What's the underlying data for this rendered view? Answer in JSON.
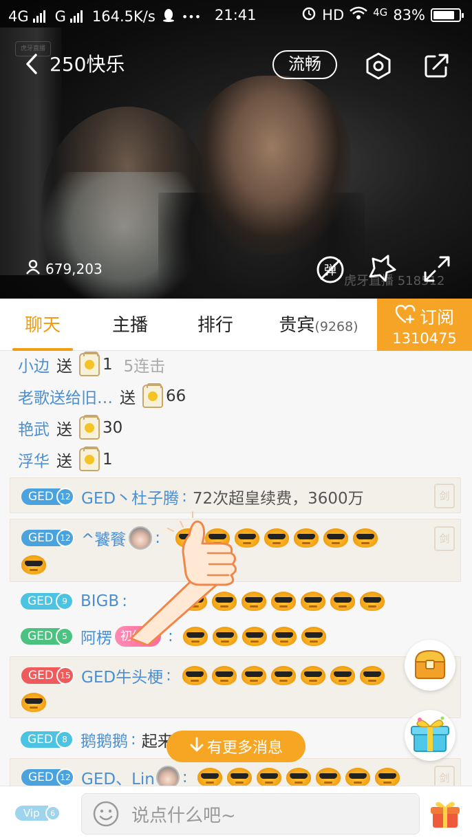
{
  "status_bar": {
    "network1": "4G",
    "network2": "G",
    "speed": "164.5K/s",
    "dots": "•••",
    "time": "21:41",
    "hd": "HD",
    "net_type": "4G",
    "battery": "83%",
    "battery_level": 0.83
  },
  "video": {
    "title": "250快乐",
    "quality_label": "流畅",
    "viewer_count": "679,203",
    "watermark_br": "虎牙直播 518512",
    "watermark_tl": "虎牙直播"
  },
  "tabs": [
    {
      "label": "聊天"
    },
    {
      "label": "主播"
    },
    {
      "label": "排行"
    },
    {
      "label": "贵宾",
      "count": "(9268)"
    }
  ],
  "subscribe": {
    "label": "订阅",
    "count": "1310475"
  },
  "gifts": [
    {
      "user": "小边",
      "verb": "送",
      "num": "1",
      "combo": "5连击"
    },
    {
      "user": "老歌送给旧…",
      "verb": "送",
      "num": "66"
    },
    {
      "user": "艳武",
      "verb": "送",
      "num": "30"
    },
    {
      "user": "浮华",
      "verb": "送",
      "num": "1"
    }
  ],
  "messages": [
    {
      "badge": "GED",
      "level": "12",
      "name": "GED丶杜子腾",
      "colon": ":",
      "text": "72次超皇续费，3600万"
    },
    {
      "badge": "GED",
      "level": "12",
      "name": "^饕餮",
      "colon": ":"
    },
    {
      "badge": "GED",
      "level": "9",
      "name": "BIGB",
      "colon": ":"
    },
    {
      "badge": "GED",
      "level": "5",
      "name": "阿楞",
      "colon": ":",
      "tag": "初体验"
    },
    {
      "badge": "GED",
      "level": "15",
      "name": "GED牛头梗",
      "colon": ":"
    },
    {
      "badge": "GED",
      "level": "8",
      "name": "鹅鹅鹅",
      "colon": ":",
      "text": "起来了"
    },
    {
      "badge": "GED",
      "level": "12",
      "name": "GED、Lin",
      "colon": ":"
    }
  ],
  "sword_label": "剑",
  "more_messages": "有更多消息",
  "bottom": {
    "vip_label": "Vip",
    "vip_level": "6",
    "placeholder": "说点什么吧~"
  },
  "icons": {
    "back": "chevron-left-icon",
    "settings": "hexagon-settings-icon",
    "share": "share-icon",
    "viewer": "person-icon",
    "danmu": "danmu-off-icon",
    "star": "star-icon",
    "fullscreen": "fullscreen-icon",
    "chest": "treasure-chest-icon",
    "gift_box": "gift-box-icon",
    "emoji": "smiley-icon",
    "gift": "gift-icon"
  },
  "colors": {
    "accent": "#f39c12",
    "subscribe_bg": "#f5a425",
    "username": "#4a8fd3"
  }
}
